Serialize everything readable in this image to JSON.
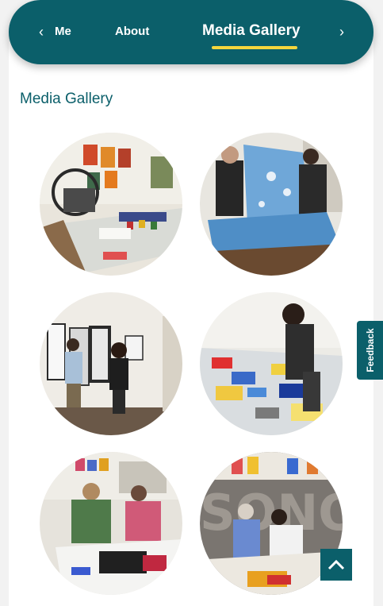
{
  "nav": {
    "prev_icon": "chevron-left-icon",
    "next_icon": "chevron-right-icon",
    "tabs": [
      {
        "label": "Me"
      },
      {
        "label": "About"
      },
      {
        "label": "Media Gallery",
        "active": true
      }
    ],
    "accent_color": "#0b5f6a",
    "underline_color": "#f5d63d"
  },
  "main": {
    "title": "Media Gallery",
    "gallery": [
      {
        "subject": "print studio with press and ink table"
      },
      {
        "subject": "two people lifting a blue print"
      },
      {
        "subject": "visitors viewing framed prints on wall"
      },
      {
        "subject": "person arranging colorful cut paper on table"
      },
      {
        "subject": "two people screen printing at table"
      },
      {
        "subject": "people working on print beneath sign"
      }
    ]
  },
  "feedback": {
    "label": "Feedback"
  },
  "back_to_top": {
    "icon": "chevron-up-icon"
  }
}
